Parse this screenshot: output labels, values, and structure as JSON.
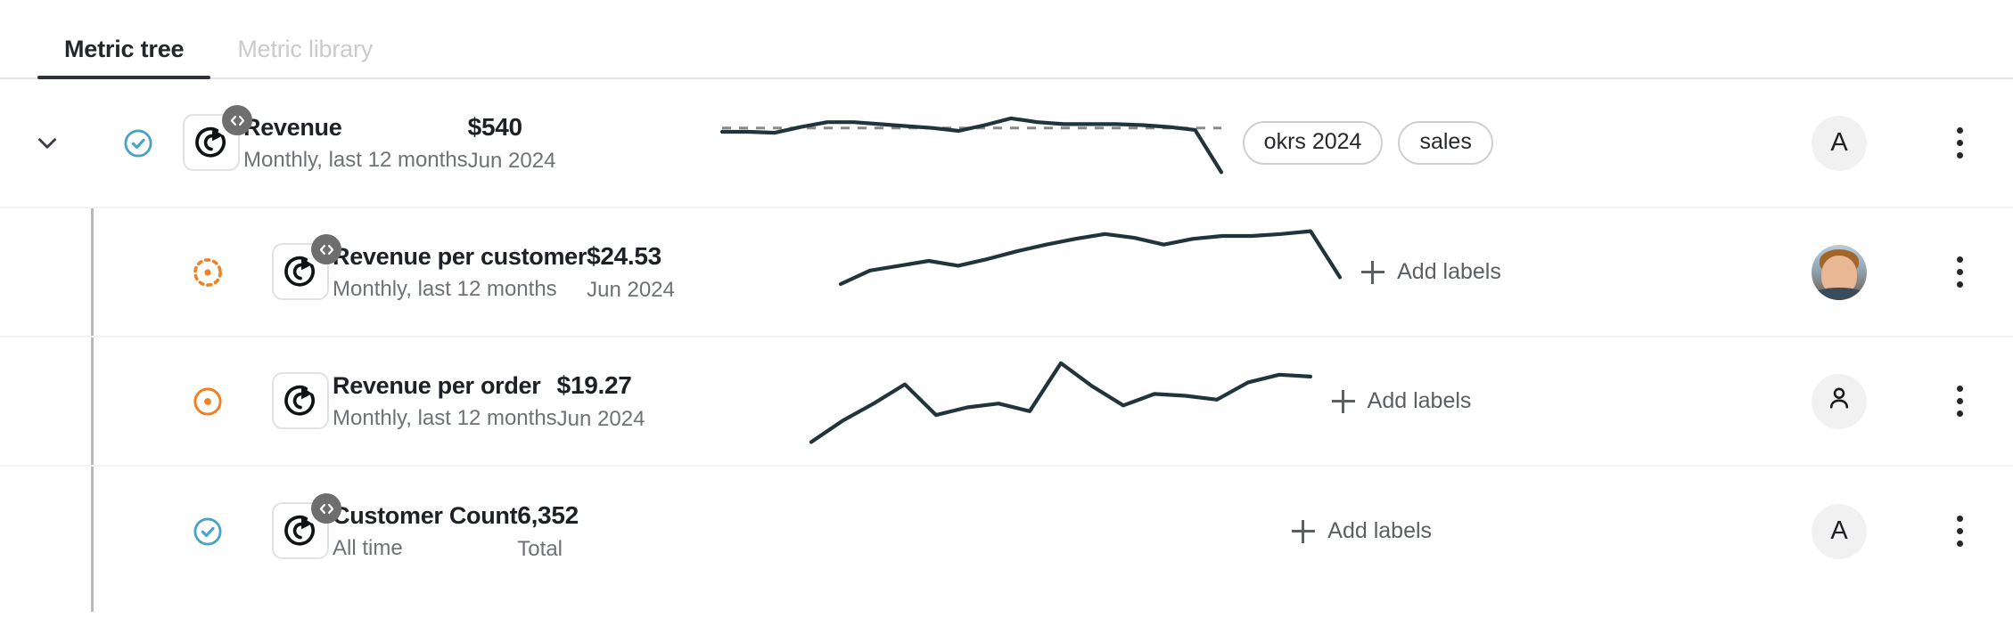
{
  "tabs": [
    {
      "label": "Metric tree",
      "active": true
    },
    {
      "label": "Metric library",
      "active": false
    }
  ],
  "colors": {
    "accent_blue": "#49a3c4",
    "accent_orange": "#f08022",
    "spark_line": "#20353b",
    "target_line": "#8a8a8a",
    "tab_active": "#23262a",
    "tab_inactive": "#cbcbcb",
    "code_badge": "#6e6e6e"
  },
  "add_labels_label": "Add labels",
  "rows": [
    {
      "name": "Revenue",
      "description": "Monthly, last 12 months",
      "value": "$540",
      "period": "Jun 2024",
      "status": "check-circle",
      "status_color": "#49a3c4",
      "has_code_badge": true,
      "expanded": true,
      "child": false,
      "labels": [
        "okrs 2024",
        "sales"
      ],
      "avatar_type": "initial",
      "avatar_text": "A"
    },
    {
      "name": "Revenue per customer",
      "description": "Monthly, last 12 months",
      "value": "$24.53",
      "period": "Jun 2024",
      "status": "dashed-circle-dot",
      "status_color": "#f08022",
      "has_code_badge": true,
      "expanded": false,
      "child": true,
      "labels": [],
      "avatar_type": "photo",
      "avatar_text": ""
    },
    {
      "name": "Revenue per order",
      "description": "Monthly, last 12 months",
      "value": "$19.27",
      "period": "Jun 2024",
      "status": "solid-circle-dot",
      "status_color": "#f08022",
      "has_code_badge": false,
      "expanded": false,
      "child": true,
      "labels": [],
      "avatar_type": "person",
      "avatar_text": ""
    },
    {
      "name": "Customer Count",
      "description": "All time",
      "value": "6,352",
      "period": "Total",
      "status": "check-circle",
      "status_color": "#49a3c4",
      "has_code_badge": true,
      "expanded": false,
      "child": true,
      "labels": [],
      "avatar_type": "initial",
      "avatar_text": "A"
    }
  ],
  "chart_data": [
    {
      "type": "line",
      "title": "Revenue",
      "series": [
        {
          "name": "Revenue",
          "values": [
            62,
            62,
            61,
            67,
            72,
            72,
            70,
            68,
            66,
            63,
            69,
            76,
            72,
            70,
            70,
            70,
            69,
            67,
            64,
            20
          ]
        }
      ],
      "target_line": 66,
      "has_target_line": true,
      "grid": false,
      "legend": false,
      "xlabel": "",
      "ylabel": "",
      "ylim": [
        0,
        100
      ]
    },
    {
      "type": "line",
      "title": "Revenue per customer",
      "series": [
        {
          "name": "Revenue per customer",
          "values": [
            38,
            52,
            57,
            62,
            57,
            64,
            72,
            79,
            85,
            90,
            86,
            79,
            85,
            88,
            88,
            90,
            93,
            45
          ]
        }
      ],
      "has_target_line": false,
      "grid": false,
      "legend": false,
      "xlabel": "",
      "ylabel": "",
      "ylim": [
        0,
        100
      ]
    },
    {
      "type": "line",
      "title": "Revenue per order",
      "series": [
        {
          "name": "Revenue per order",
          "values": [
            8,
            30,
            48,
            68,
            36,
            44,
            48,
            40,
            90,
            66,
            46,
            58,
            56,
            52,
            70,
            78,
            76
          ]
        }
      ],
      "has_target_line": false,
      "grid": false,
      "legend": false,
      "xlabel": "",
      "ylabel": "",
      "ylim": [
        0,
        100
      ]
    },
    {
      "type": "line",
      "title": "Customer Count",
      "series": [],
      "has_target_line": false,
      "grid": false,
      "legend": false,
      "xlabel": "",
      "ylabel": "",
      "ylim": [
        0,
        100
      ]
    }
  ]
}
